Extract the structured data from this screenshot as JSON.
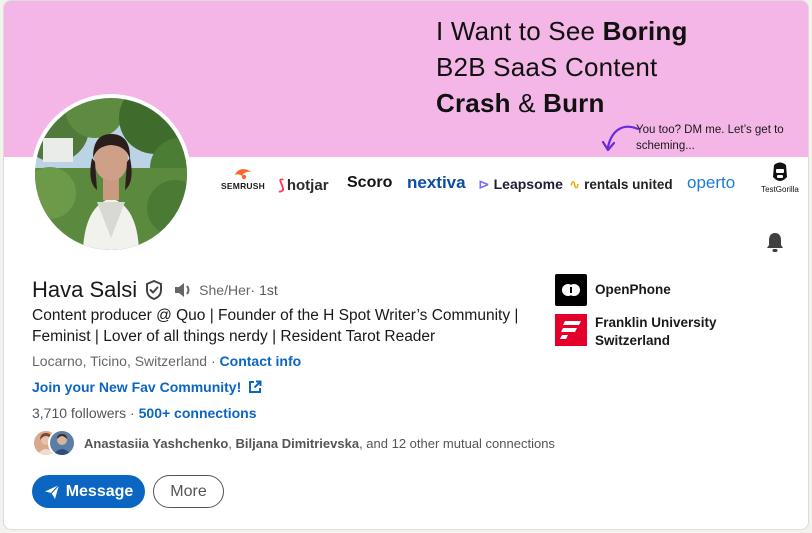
{
  "banner": {
    "headline_line1_prefix": "I Want to See ",
    "headline_line1_bold": "Boring",
    "headline_line2": "B2B SaaS Content",
    "headline_line3_bold1": "Crash",
    "headline_line3_mid": " & ",
    "headline_line3_bold2": "Burn",
    "note": "You too? DM me. Let’s get to scheming...",
    "background_color": "#f3b6e6"
  },
  "logos": {
    "semrush": "SEMRUSH",
    "hotjar": "hotjar",
    "scoro": "Scoro",
    "nextiva": "nextiva",
    "leapsome": "Leapsome",
    "rentals_united": "rentals united",
    "operto": "operto",
    "testgorilla": "TestGorilla"
  },
  "profile": {
    "name": "Hava Salsi",
    "pronouns": "She/Her",
    "degree": " · 1st",
    "headline": "Content producer @ Quo | Founder of the H Spot Writer’s Community | Feminist | Lover of all things nerdy | Resident Tarot Reader",
    "location": "Locarno, Ticino, Switzerland",
    "location_sep": " · ",
    "contact_info": "Contact info",
    "website_label": "Join your New Fav Community!",
    "followers": "3,710 followers",
    "stats_sep": " · ",
    "connections": "500+ connections",
    "mutual_name1": "Anastasiia Yashchenko",
    "mutual_sep": ", ",
    "mutual_name2": "Biljana Dimitrievska",
    "mutual_rest": ", and 12 other mutual connections"
  },
  "actions": {
    "message": "Message",
    "more": "More"
  },
  "organizations": [
    {
      "name": "OpenPhone"
    },
    {
      "name": "Franklin University Switzerland"
    }
  ],
  "colors": {
    "accent": "#0a66c2",
    "openphone_logo": "#000000",
    "franklin_logo": "#e4002b"
  },
  "icons": {
    "verified": "shield-check-icon",
    "pronunciation": "speaker-icon",
    "notifications": "bell-icon",
    "external": "external-link-icon",
    "message": "send-icon"
  }
}
